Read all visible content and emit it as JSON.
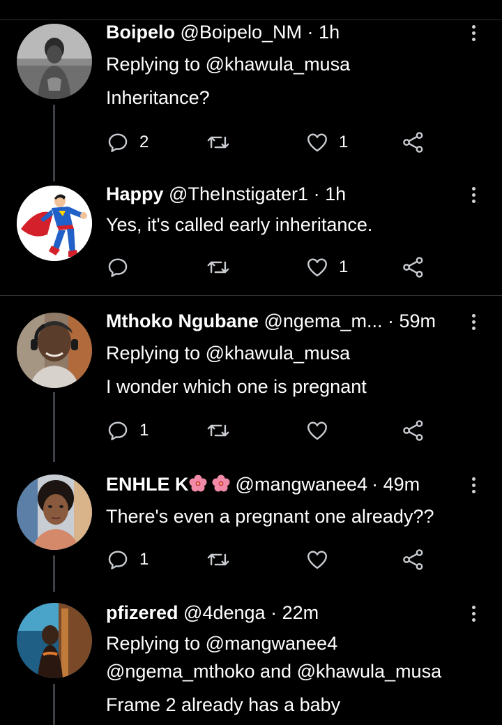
{
  "tweets": [
    {
      "name": "Boipelo",
      "handle": "@Boipelo_NM",
      "sep": "·",
      "time": "1h",
      "replying": "Replying to @khawula_musa",
      "text": "Inheritance?",
      "counts": {
        "reply": "2",
        "retweet": "",
        "like": "1"
      }
    },
    {
      "name": "Happy",
      "handle": "@TheInstigater1",
      "sep": "·",
      "time": "1h",
      "text": "Yes, it's called early inheritance.",
      "counts": {
        "reply": "",
        "retweet": "",
        "like": "1"
      }
    },
    {
      "name": "Mthoko Ngubane",
      "handle": "@ngema_m...",
      "sep": "·",
      "time": "59m",
      "replying": "Replying to @khawula_musa",
      "text": "I wonder which one is pregnant",
      "counts": {
        "reply": "1",
        "retweet": "",
        "like": ""
      }
    },
    {
      "name": "ENHLE K",
      "handle": "@mangwanee4",
      "sep": "·",
      "time": "49m",
      "name_emoji": [
        "hibiscus-emoji",
        "hibiscus-emoji"
      ],
      "text": "There's even a pregnant one already??",
      "counts": {
        "reply": "1",
        "retweet": "",
        "like": ""
      }
    },
    {
      "name": "pfizered",
      "handle": "@4denga",
      "sep": "·",
      "time": "22m",
      "replying": "Replying to @mangwanee4",
      "replying2": "@ngema_mthoko and @khawula_musa",
      "text": "Frame 2 already has a baby"
    }
  ],
  "icons": {
    "reply": "reply-icon",
    "retweet": "retweet-icon",
    "like": "heart-icon",
    "share": "share-icon",
    "more": "more-vertical-icon"
  },
  "colors": {
    "background": "#000000",
    "text": "#ffffff",
    "icon": "#c9cdd1",
    "divider": "#2f3336"
  }
}
